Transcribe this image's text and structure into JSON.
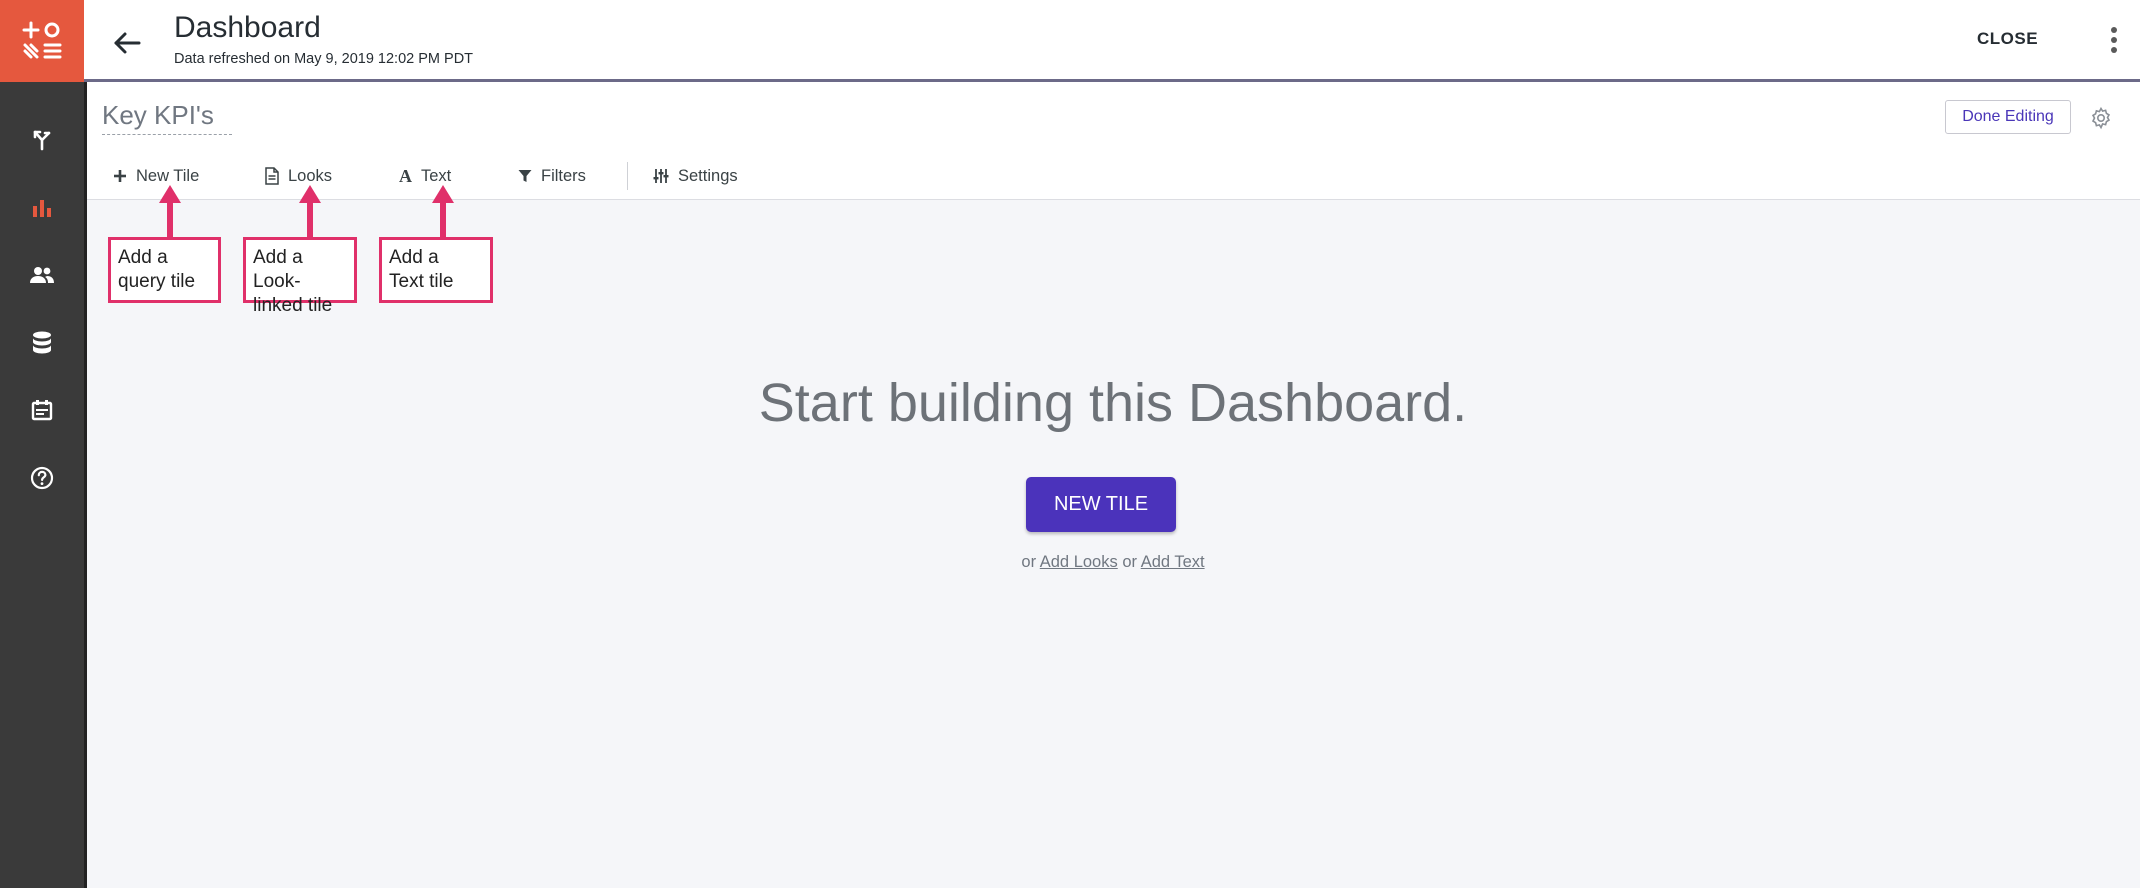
{
  "header": {
    "title": "Dashboard",
    "subtitle": "Data refreshed on May 9, 2019 12:02 PM PDT",
    "close_label": "CLOSE"
  },
  "sidebar": {
    "brand_color": "#e5583e",
    "items": [
      {
        "icon": "explore-icon"
      },
      {
        "icon": "bar-chart-icon",
        "active": true
      },
      {
        "icon": "people-icon"
      },
      {
        "icon": "database-icon"
      },
      {
        "icon": "calendar-icon"
      },
      {
        "icon": "help-icon"
      }
    ]
  },
  "toolbar": {
    "dashboard_name": "Key KPI's",
    "done_label": "Done Editing",
    "items": [
      {
        "icon": "plus-icon",
        "label": "New Tile"
      },
      {
        "icon": "document-icon",
        "label": "Looks"
      },
      {
        "icon": "text-icon",
        "label": "Text"
      },
      {
        "icon": "filter-icon",
        "label": "Filters"
      },
      {
        "icon": "sliders-icon",
        "label": "Settings"
      }
    ]
  },
  "annotations": [
    {
      "line1": "Add a",
      "line2": "query tile"
    },
    {
      "line1": "Add a Look-",
      "line2": "linked tile"
    },
    {
      "line1": "Add a",
      "line2": "Text tile"
    }
  ],
  "empty_state": {
    "title": "Start building this Dashboard.",
    "button_label": "NEW TILE",
    "or1": "or",
    "link_looks": "Add Looks",
    "or2": "or",
    "link_text": "Add Text",
    "accent_color": "#4b33bb"
  }
}
